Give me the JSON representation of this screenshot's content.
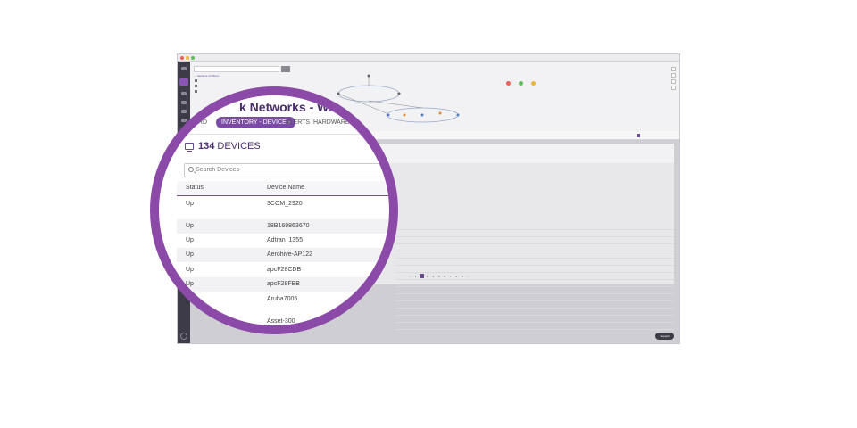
{
  "window": {
    "colors": {
      "close": "#e8625a",
      "min": "#e9b63d",
      "max": "#5fbd57",
      "accent": "#7b4aa6",
      "ring": "#8b4aa8"
    }
  },
  "topology": {
    "breadcrumb": "← Sections of Others"
  },
  "header": {
    "title": "k Networks - Waterloo",
    "tabs": {
      "partial": "RD",
      "inventory": "INVENTORY - DEVICE ›",
      "alerts": "ALERTS",
      "hardware": "HARDWARE LIFE"
    }
  },
  "devices": {
    "icon": "monitor-icon",
    "count": "134",
    "label": "DEVICES",
    "search_placeholder": "Search Devices",
    "columns": {
      "status": "Status",
      "name": "Device Name"
    },
    "rows": [
      {
        "status": "Up",
        "name": "3COM_2920"
      },
      {
        "status": "Up",
        "name": "18B169863670"
      },
      {
        "status": "Up",
        "name": "Adtran_1355"
      },
      {
        "status": "Up",
        "name": "Aerohive-AP122"
      },
      {
        "status": "Up",
        "name": "apcF28CDB"
      },
      {
        "status": "Up",
        "name": "apcF28FBB"
      },
      {
        "status": "",
        "name": "Aruba7005"
      },
      {
        "status": "",
        "name": "Asset-300"
      }
    ]
  },
  "pager": {
    "pages": "‹ 1 2 3 4 5 6 7 8 9 ›"
  },
  "support_label": "Support"
}
